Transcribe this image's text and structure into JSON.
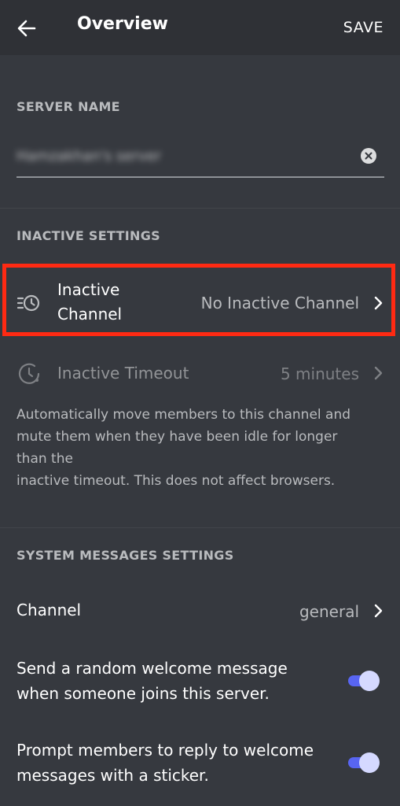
{
  "header": {
    "title": "Overview",
    "save_label": "SAVE"
  },
  "server_name": {
    "section_label": "SERVER NAME",
    "value": "Hamzakhan's server"
  },
  "inactive": {
    "section_label": "INACTIVE SETTINGS",
    "channel": {
      "label_line1": "Inactive",
      "label_line2": "Channel",
      "value": "No Inactive Channel"
    },
    "timeout": {
      "label": "Inactive Timeout",
      "value": "5 minutes"
    },
    "description_lines": [
      "Automatically move members to this channel and",
      "mute them when they have been idle for longer",
      "than the",
      "inactive timeout. This does not affect browsers."
    ]
  },
  "system": {
    "section_label": "SYSTEM MESSAGES SETTINGS",
    "channel": {
      "label": "Channel",
      "value": "general"
    },
    "welcome": {
      "lines": [
        "Send a random welcome message",
        "when someone joins this server."
      ],
      "enabled": true
    },
    "sticker": {
      "lines": [
        "Prompt members to reply to welcome",
        "messages with a sticker."
      ],
      "enabled": true
    }
  },
  "icons": [
    "arrow-left-icon",
    "clear-icon",
    "channel-clock-icon",
    "clock-icon",
    "chevron-right-icon"
  ],
  "colors": {
    "accent": "#5865f2",
    "highlight": "#ff2a13",
    "background": "#36393f",
    "header": "#2f3136"
  }
}
